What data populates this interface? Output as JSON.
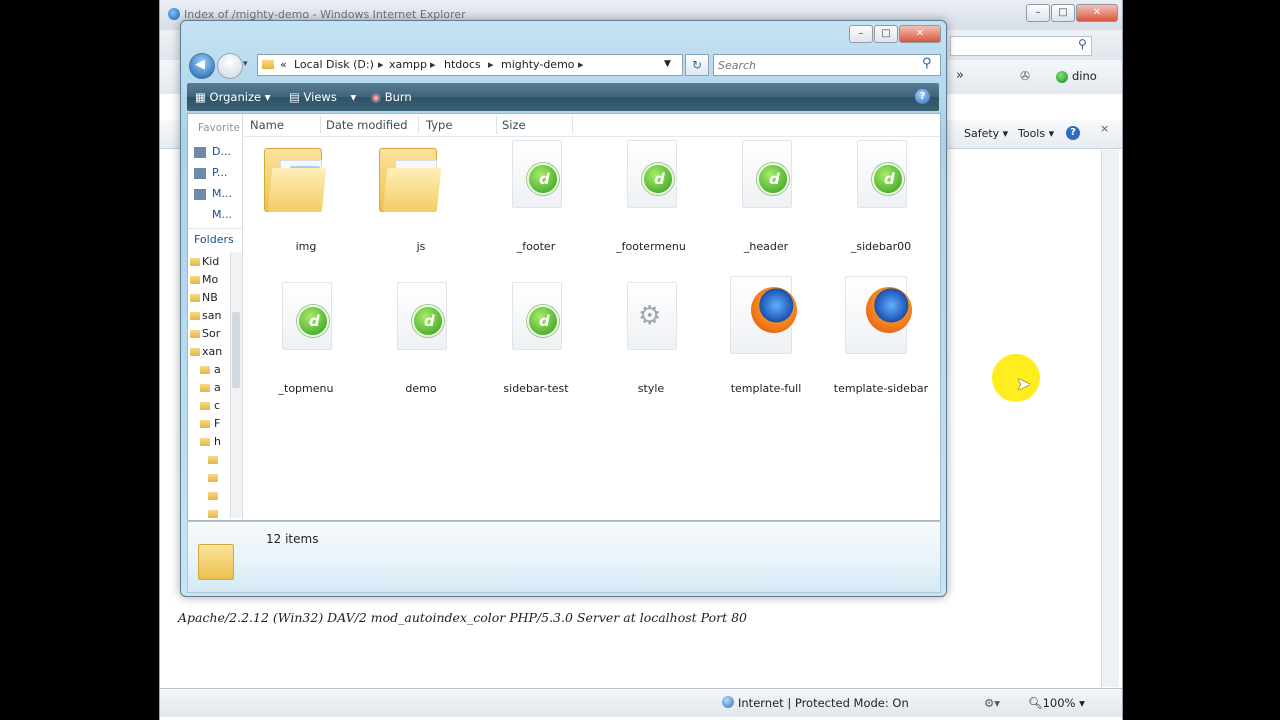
{
  "ie": {
    "title": "Index of /mighty-demo - Windows Internet Explorer",
    "window_buttons": [
      "–",
      "□",
      "✕"
    ],
    "toolbar_user": "dino",
    "commands": {
      "safety": "Safety",
      "tools": "Tools"
    },
    "footer_text": "Apache/2.2.12 (Win32) DAV/2 mod_autoindex_color PHP/5.3.0 Server at localhost Port 80",
    "status": {
      "zone": "Internet | Protected Mode: On",
      "zoom": "100%"
    }
  },
  "explorer": {
    "window_buttons": [
      "–",
      "□",
      "✕"
    ],
    "breadcrumb": [
      "«",
      "Local Disk (D:)",
      "xampp",
      "htdocs",
      "mighty-demo"
    ],
    "search_placeholder": "Search",
    "toolbar": {
      "organize": "Organize",
      "views": "Views",
      "burn": "Burn"
    },
    "nav": {
      "favorites_label": "Favorite",
      "favorite_links": [
        "D...",
        "P...",
        "M...",
        "M..."
      ],
      "folders_label": "Folders",
      "tree_items": [
        "Kid",
        "Mo",
        "NB",
        "san",
        "Sor",
        "xan",
        "a",
        "a",
        "c",
        "F",
        "h",
        "",
        "",
        "",
        ""
      ]
    },
    "columns": [
      "Name",
      "Date modified",
      "Type",
      "Size"
    ],
    "items": [
      {
        "label": "img",
        "kind": "folder-img"
      },
      {
        "label": "js",
        "kind": "folder"
      },
      {
        "label": "_footer",
        "kind": "dreamweaver"
      },
      {
        "label": "_footermenu",
        "kind": "dreamweaver"
      },
      {
        "label": "_header",
        "kind": "dreamweaver"
      },
      {
        "label": "_sidebar00",
        "kind": "dreamweaver"
      },
      {
        "label": "_topmenu",
        "kind": "dreamweaver"
      },
      {
        "label": "demo",
        "kind": "dreamweaver"
      },
      {
        "label": "sidebar-test",
        "kind": "dreamweaver"
      },
      {
        "label": "style",
        "kind": "css"
      },
      {
        "label": "template-full",
        "kind": "firefox"
      },
      {
        "label": "template-sidebar",
        "kind": "firefox"
      }
    ],
    "details": {
      "count": "12 items"
    }
  },
  "colors": {
    "toolbar": "#3e6479",
    "explorer_frame": "#a9d2ea",
    "cursor_highlight": "#ffec13"
  }
}
